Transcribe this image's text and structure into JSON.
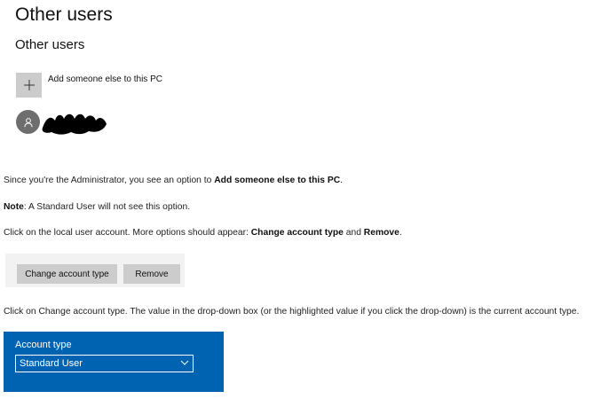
{
  "settings": {
    "title": "Other users",
    "section_title": "Other users",
    "add_label": "Add someone else to this PC",
    "add_icon": "plus-icon",
    "user_icon": "person-icon"
  },
  "article": {
    "p1_pre": "Since you're the Administrator, you see an option to ",
    "p1_bold": "Add someone else to this PC",
    "p1_post": ".",
    "p2_bold": "Note",
    "p2_post": ": A Standard User will not see this option.",
    "p3_pre": "Click on the local user account. More options should appear: ",
    "p3_bold1": "Change account type",
    "p3_mid": " and ",
    "p3_bold2": "Remove",
    "p3_post": ".",
    "p4": "Click on Change account type. The value in the drop-down box (or the highlighted value if you click the drop-down) is the current account type."
  },
  "buttons": {
    "change_label": "Change account type",
    "remove_label": "Remove"
  },
  "account_type": {
    "label": "Account type",
    "selected": "Standard User",
    "chevron_icon": "chevron-down-icon"
  },
  "colors": {
    "accent_blue": "#0063b1",
    "button_gray": "#cccccc",
    "avatar_gray": "#6e6e6e"
  }
}
